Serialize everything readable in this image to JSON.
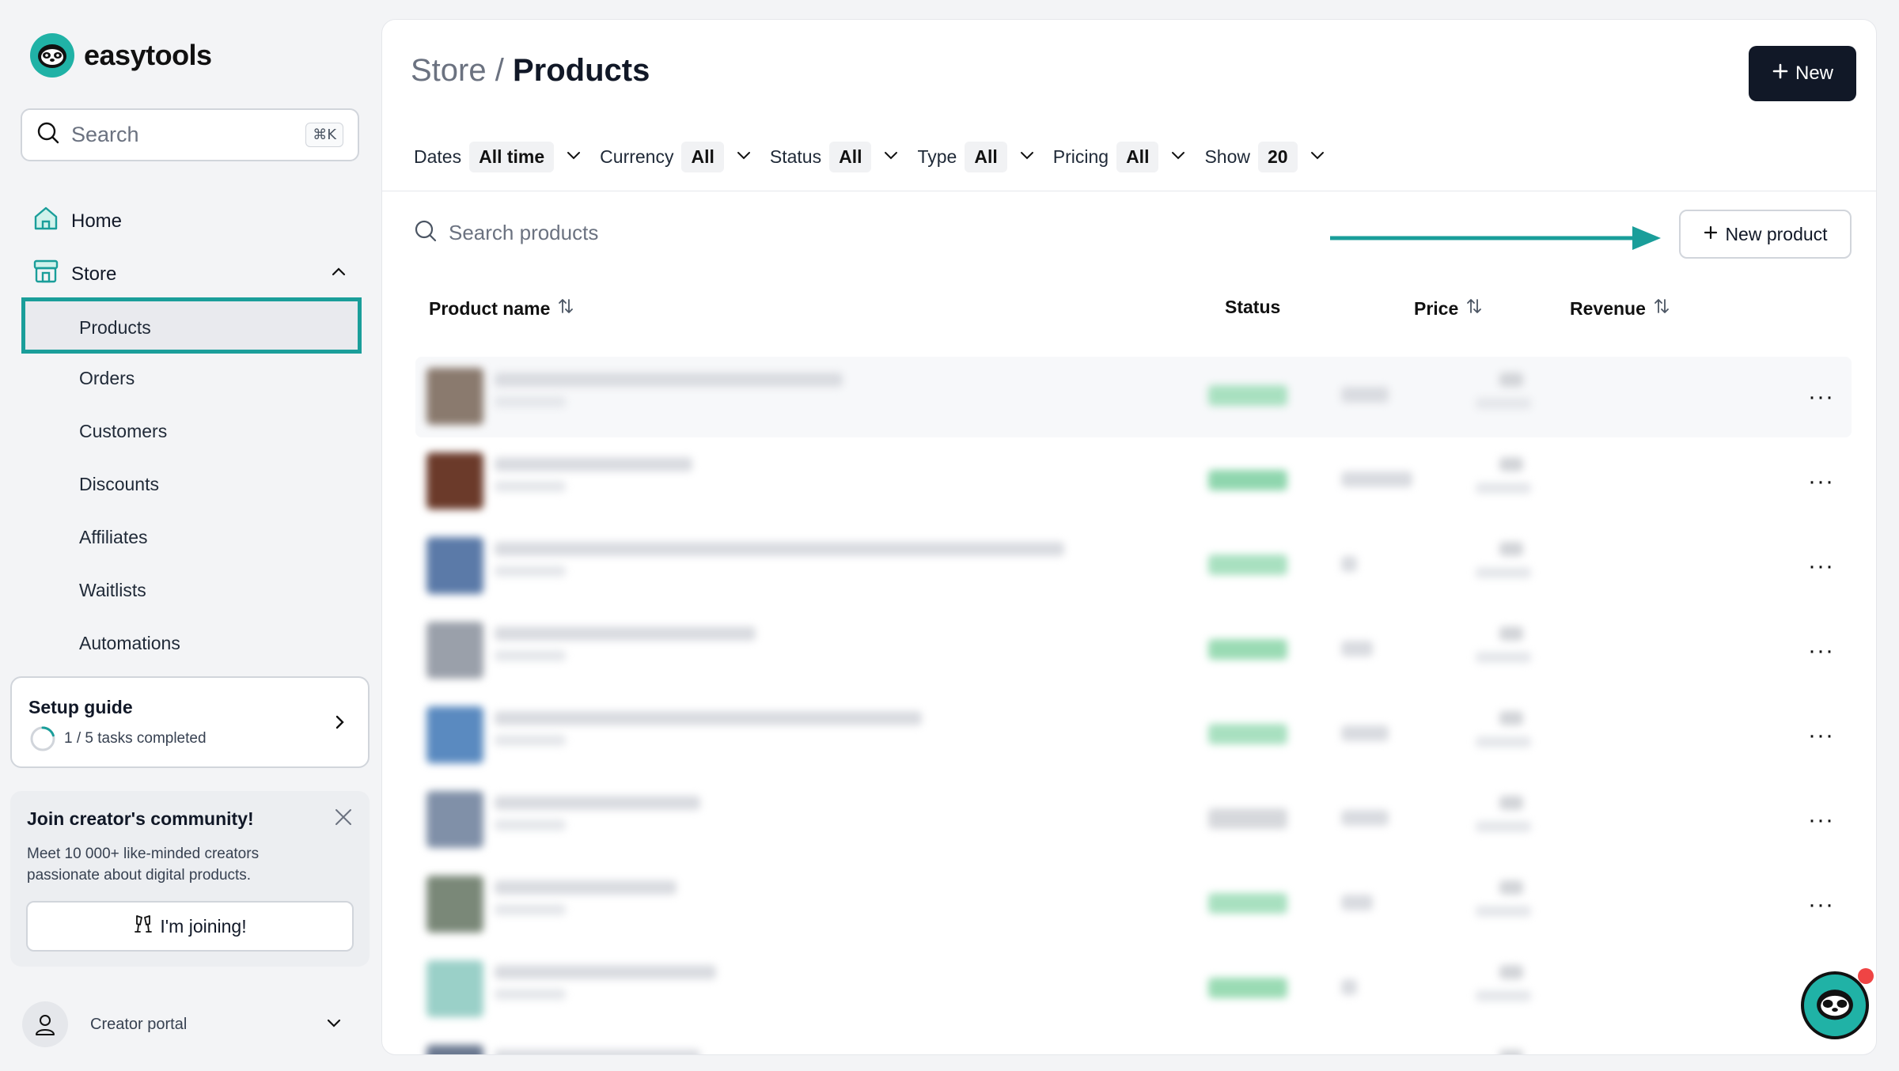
{
  "app": {
    "name": "easytools"
  },
  "sidebar": {
    "search": {
      "placeholder": "Search",
      "shortcut": "⌘K"
    },
    "nav": {
      "home": "Home",
      "store": "Store"
    },
    "store_items": [
      "Products",
      "Orders",
      "Customers",
      "Discounts",
      "Affiliates",
      "Waitlists",
      "Automations"
    ],
    "active_item": "Products",
    "setup_guide": {
      "title": "Setup guide",
      "progress": "1 / 5 tasks completed",
      "completed": 1,
      "total": 5
    },
    "community": {
      "title": "Join creator's community!",
      "description": "Meet 10 000+ like-minded creators passionate about digital products.",
      "button": "I'm joining!"
    },
    "portal": {
      "label": "Creator portal"
    }
  },
  "header": {
    "breadcrumb": "Store",
    "separator": "/",
    "title": "Products",
    "new_button": "New"
  },
  "filters": [
    {
      "key": "Dates",
      "value": "All time"
    },
    {
      "key": "Currency",
      "value": "All"
    },
    {
      "key": "Status",
      "value": "All"
    },
    {
      "key": "Type",
      "value": "All"
    },
    {
      "key": "Pricing",
      "value": "All"
    },
    {
      "key": "Show",
      "value": "20"
    }
  ],
  "products": {
    "search_placeholder": "Search products",
    "new_button": "New product",
    "columns": {
      "name": "Product name",
      "status": "Status",
      "price": "Price",
      "revenue": "Revenue"
    },
    "row_menu": "···"
  },
  "colors": {
    "accent": "#1a9e9a",
    "brand": "#20b2a6",
    "dark": "#111827",
    "status_green": "#86d4a6",
    "notification": "#ef4444"
  }
}
